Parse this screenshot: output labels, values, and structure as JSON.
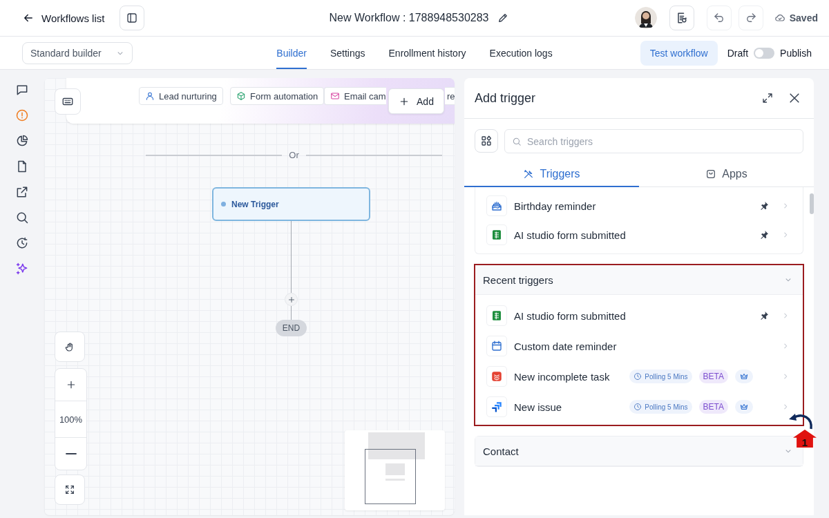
{
  "topbar": {
    "back_link": "Workflows list",
    "title": "New Workflow : 1788948530283",
    "save_status": "Saved"
  },
  "toolbar": {
    "builder_mode": "Standard builder",
    "tabs": [
      {
        "label": "Builder",
        "selected": true
      },
      {
        "label": "Settings",
        "selected": false
      },
      {
        "label": "Enrollment history",
        "selected": false
      },
      {
        "label": "Execution logs",
        "selected": false
      }
    ],
    "test_button": "Test workflow",
    "publish_toggle": {
      "off_label": "Draft",
      "on_label": "Publish",
      "on": false
    }
  },
  "rail": [
    {
      "kind": "chat"
    },
    {
      "kind": "alert"
    },
    {
      "kind": "pie"
    },
    {
      "kind": "doc"
    },
    {
      "kind": "external"
    },
    {
      "kind": "search"
    },
    {
      "kind": "history"
    },
    {
      "kind": "sparkle"
    }
  ],
  "canvas": {
    "template_chips": [
      {
        "kind": "person",
        "label": "Lead nurturing"
      },
      {
        "kind": "cube",
        "label": "Form automation"
      },
      {
        "kind": "mail",
        "label": "Email cam"
      },
      {
        "kind": "plain",
        "label": "re"
      }
    ],
    "add_button": "Add",
    "divider_label": "Or",
    "trigger_node": "New Trigger",
    "end_label": "END",
    "zoom_level": "100%"
  },
  "panel": {
    "title": "Add trigger",
    "search": {
      "placeholder": "Search triggers"
    },
    "tabs": [
      {
        "kind": "tools",
        "label": "Triggers",
        "selected": true
      },
      {
        "kind": "bag",
        "label": "Apps",
        "selected": false
      }
    ],
    "sections": [
      {
        "items": [
          {
            "kind": "cake",
            "label": "Birthday reminder",
            "pinned": true
          },
          {
            "kind": "sheet",
            "label": "AI studio form submitted",
            "pinned": true
          }
        ]
      },
      {
        "title": "Recent triggers",
        "highlighted": true,
        "items": [
          {
            "kind": "sheet",
            "label": "AI studio form submitted",
            "pinned": true
          },
          {
            "kind": "calendar",
            "label": "Custom date reminder",
            "pinned": false
          },
          {
            "kind": "task",
            "label": "New incomplete task",
            "pinned": false,
            "polling": "Polling 5 Mins",
            "beta": "BETA",
            "premium": true
          },
          {
            "kind": "issue",
            "label": "New issue",
            "pinned": false,
            "polling": "Polling 5 Mins",
            "beta": "BETA",
            "premium": true
          }
        ]
      },
      {
        "title": "Contact"
      }
    ]
  },
  "annotation": {
    "step": "1"
  }
}
